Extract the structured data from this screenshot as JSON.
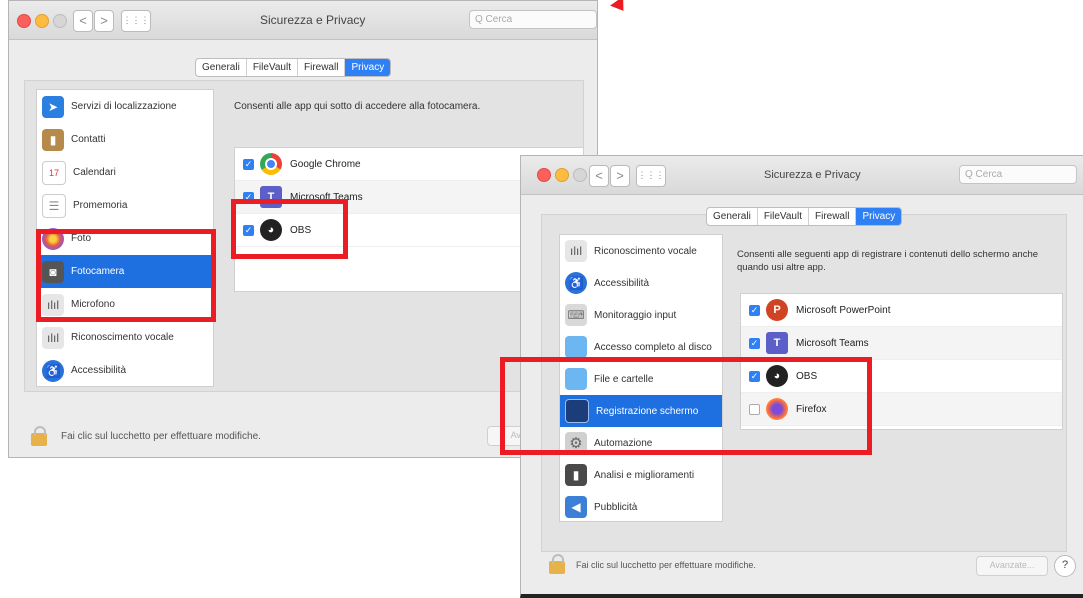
{
  "window1": {
    "title": "Sicurezza e Privacy",
    "nav_back": "<",
    "nav_forward": ">",
    "grid_button": "⋮⋮⋮",
    "search_placeholder": "Q  Cerca",
    "tabs": [
      "Generali",
      "FileVault",
      "Firewall",
      "Privacy"
    ],
    "active_tab": "Privacy",
    "sidebar": [
      {
        "label": "Servizi di localizzazione",
        "icon": "location-arrow-icon"
      },
      {
        "label": "Contatti",
        "icon": "contacts-book-icon"
      },
      {
        "label": "Calendari",
        "icon": "calendar-icon"
      },
      {
        "label": "Promemoria",
        "icon": "reminders-list-icon"
      },
      {
        "label": "Foto",
        "icon": "photos-flower-icon"
      },
      {
        "label": "Fotocamera",
        "icon": "camera-icon",
        "selected": true
      },
      {
        "label": "Microfono",
        "icon": "microphone-waveform-icon"
      },
      {
        "label": "Riconoscimento vocale",
        "icon": "speech-waveform-icon"
      },
      {
        "label": "Accessibilità",
        "icon": "accessibility-icon"
      }
    ],
    "description": "Consenti alle app qui sotto di accedere alla fotocamera.",
    "apps": [
      {
        "name": "Google Chrome",
        "checked": true,
        "icon": "chrome-icon"
      },
      {
        "name": "Microsoft Teams",
        "checked": true,
        "icon": "teams-icon"
      },
      {
        "name": "OBS",
        "checked": true,
        "icon": "obs-icon"
      }
    ],
    "lock_text": "Fai clic sul lucchetto per effettuare modifiche.",
    "advanced_label": "Avanzate..."
  },
  "window2": {
    "title": "Sicurezza e Privacy",
    "nav_back": "<",
    "nav_forward": ">",
    "grid_button": "⋮⋮⋮",
    "search_placeholder": "Q  Cerca",
    "tabs": [
      "Generali",
      "FileVault",
      "Firewall",
      "Privacy"
    ],
    "active_tab": "Privacy",
    "sidebar": [
      {
        "label": "Riconoscimento vocale",
        "icon": "speech-waveform-icon"
      },
      {
        "label": "Accessibilità",
        "icon": "accessibility-icon"
      },
      {
        "label": "Monitoraggio input",
        "icon": "keyboard-icon"
      },
      {
        "label": "Accesso completo al disco",
        "icon": "folder-icon"
      },
      {
        "label": "File e cartelle",
        "icon": "folder-icon"
      },
      {
        "label": "Registrazione schermo",
        "icon": "display-icon",
        "selected": true
      },
      {
        "label": "Automazione",
        "icon": "gear-icon"
      },
      {
        "label": "Analisi e miglioramenti",
        "icon": "bar-chart-icon"
      },
      {
        "label": "Pubblicità",
        "icon": "megaphone-icon"
      }
    ],
    "description": "Consenti alle seguenti app di registrare i contenuti dello schermo anche quando usi altre app.",
    "apps": [
      {
        "name": "Microsoft PowerPoint",
        "checked": true,
        "icon": "powerpoint-icon"
      },
      {
        "name": "Microsoft Teams",
        "checked": true,
        "icon": "teams-icon"
      },
      {
        "name": "OBS",
        "checked": true,
        "icon": "obs-icon"
      },
      {
        "name": "Firefox",
        "checked": false,
        "icon": "firefox-icon"
      }
    ],
    "lock_text": "Fai clic sul lucchetto per effettuare modifiche.",
    "advanced_label": "Avanzate...",
    "help_label": "?"
  },
  "colors": {
    "highlight": "#ec1c24",
    "selection": "#1e6fe0",
    "checkbox": "#2f7ff5"
  }
}
